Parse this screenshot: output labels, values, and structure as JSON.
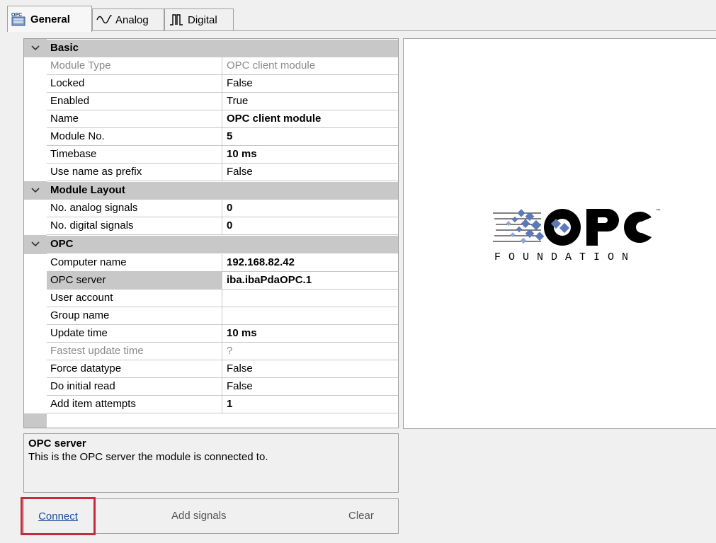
{
  "tabs": [
    {
      "label": "General",
      "icon": "opc-module-icon",
      "active": true
    },
    {
      "label": "Analog",
      "icon": "analog-wave-icon",
      "active": false
    },
    {
      "label": "Digital",
      "icon": "digital-pulse-icon",
      "active": false
    }
  ],
  "grid": {
    "basic": {
      "label": "Basic",
      "rows": [
        {
          "name": "Module Type",
          "value": "OPC client module"
        },
        {
          "name": "Locked",
          "value": "False"
        },
        {
          "name": "Enabled",
          "value": "True"
        },
        {
          "name": "Name",
          "value": "OPC client module"
        },
        {
          "name": "Module No.",
          "value": "5"
        },
        {
          "name": "Timebase",
          "value": "10 ms"
        },
        {
          "name": "Use name as prefix",
          "value": "False"
        }
      ]
    },
    "layout": {
      "label": "Module Layout",
      "rows": [
        {
          "name": "No. analog signals",
          "value": "0"
        },
        {
          "name": "No. digital signals",
          "value": "0"
        }
      ]
    },
    "opc": {
      "label": "OPC",
      "rows": [
        {
          "name": "Computer name",
          "value": "192.168.82.42"
        },
        {
          "name": "OPC server",
          "value": "iba.ibaPdaOPC.1"
        },
        {
          "name": "User account",
          "value": ""
        },
        {
          "name": "Group name",
          "value": ""
        },
        {
          "name": "Update time",
          "value": "10 ms"
        },
        {
          "name": "Fastest update time",
          "value": "?"
        },
        {
          "name": "Force datatype",
          "value": "False"
        },
        {
          "name": "Do initial read",
          "value": "False"
        },
        {
          "name": "Add item attempts",
          "value": "1"
        }
      ]
    }
  },
  "logo": {
    "text": "FOUNDATION"
  },
  "description": {
    "title": "OPC server",
    "text": "This is the OPC server the module is connected to."
  },
  "buttons": {
    "connect": "Connect",
    "add_signals": "Add signals",
    "clear": "Clear"
  },
  "colors": {
    "highlight_border": "#c42b3c",
    "link": "#1b4f9c",
    "category_bg": "#c8c8c8"
  }
}
